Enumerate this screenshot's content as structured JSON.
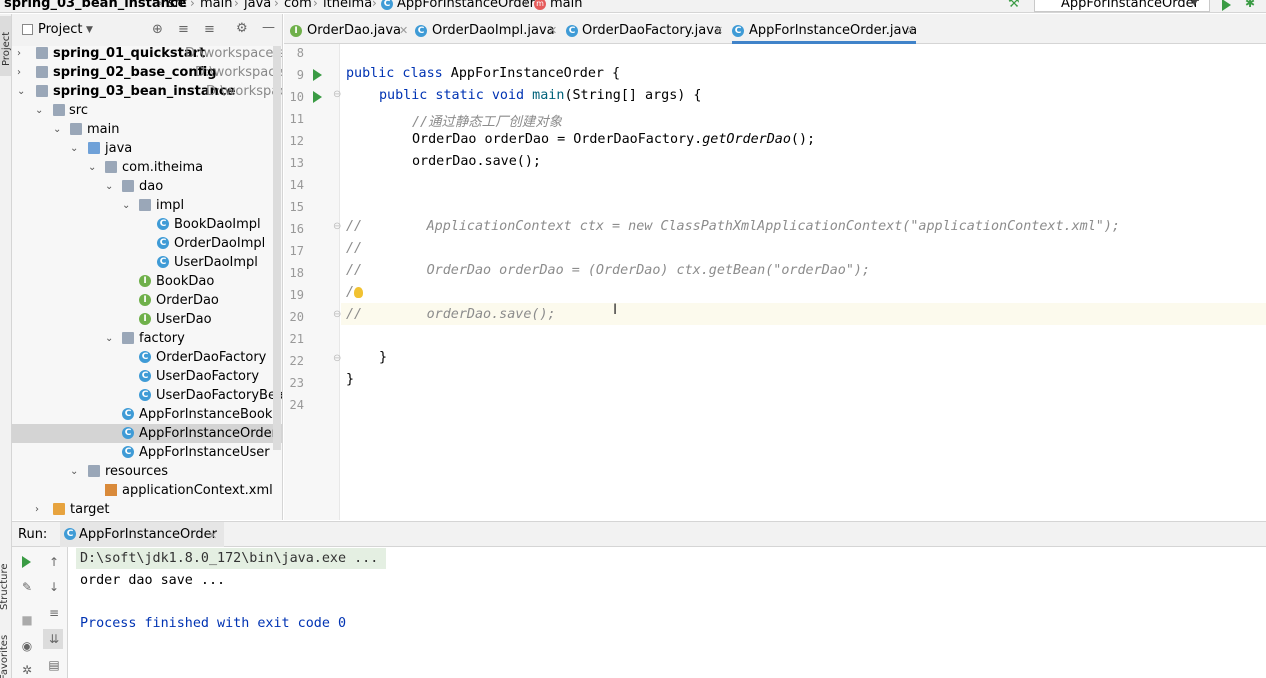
{
  "breadcrumb": [
    "spring_03_bean_instance",
    "src",
    "main",
    "java",
    "com",
    "itheima",
    "AppForInstanceOrder",
    "main"
  ],
  "run_config": {
    "label": "AppForInstanceOrder"
  },
  "side_strip": {
    "project": "Project",
    "structure": "Structure",
    "favorites": "Favorites"
  },
  "project_panel": {
    "title": "Project"
  },
  "tree": [
    {
      "label": "spring_01_quickstart",
      "path": "D:\\workspace\\sp",
      "bold": true
    },
    {
      "label": "spring_02_base_config",
      "path": "D:\\workspace\\s",
      "bold": true
    },
    {
      "label": "spring_03_bean_instance",
      "path": "D:\\workspace",
      "bold": true
    },
    {
      "label": "src"
    },
    {
      "label": "main"
    },
    {
      "label": "java"
    },
    {
      "label": "com.itheima"
    },
    {
      "label": "dao"
    },
    {
      "label": "impl"
    },
    {
      "label": "BookDaoImpl"
    },
    {
      "label": "OrderDaoImpl"
    },
    {
      "label": "UserDaoImpl"
    },
    {
      "label": "BookDao"
    },
    {
      "label": "OrderDao"
    },
    {
      "label": "UserDao"
    },
    {
      "label": "factory"
    },
    {
      "label": "OrderDaoFactory"
    },
    {
      "label": "UserDaoFactory"
    },
    {
      "label": "UserDaoFactoryBean"
    },
    {
      "label": "AppForInstanceBook"
    },
    {
      "label": "AppForInstanceOrder"
    },
    {
      "label": "AppForInstanceUser"
    },
    {
      "label": "resources"
    },
    {
      "label": "applicationContext.xml"
    },
    {
      "label": "target"
    }
  ],
  "tabs": [
    {
      "label": "OrderDao.java",
      "icon": "I"
    },
    {
      "label": "OrderDaoImpl.java",
      "icon": "C"
    },
    {
      "label": "OrderDaoFactory.java",
      "icon": "C"
    },
    {
      "label": "AppForInstanceOrder.java",
      "icon": "C",
      "active": true
    }
  ],
  "code": {
    "line_numbers": [
      "8",
      "9",
      "10",
      "11",
      "12",
      "13",
      "14",
      "15",
      "16",
      "17",
      "18",
      "19",
      "20",
      "21",
      "22",
      "23",
      "24"
    ],
    "l9": {
      "kw": "public class",
      "rest": " AppForInstanceOrder {"
    },
    "l10": {
      "kw": "public static void",
      "name": " main",
      "rest": "(String[] args) {"
    },
    "l11": "//通过静态工厂创建对象",
    "l12": {
      "a": "OrderDao orderDao = OrderDaoFactory.",
      "b": "getOrderDao",
      "c": "();"
    },
    "l13": "orderDao.save();",
    "l16": "//        ApplicationContext ctx = new ClassPathXmlApplicationContext(\"applicationContext.xml\");",
    "l17": "//",
    "l18": "//        OrderDao orderDao = (OrderDao) ctx.getBean(\"orderDao\");",
    "l19": "/",
    "l20": "//        orderDao.save();",
    "l22": "}",
    "l23": "}"
  },
  "run_panel": {
    "title": "Run:",
    "tab": "AppForInstanceOrder",
    "lines": [
      "D:\\soft\\jdk1.8.0_172\\bin\\java.exe ...",
      "order dao save ...",
      "",
      "Process finished with exit code 0"
    ]
  }
}
